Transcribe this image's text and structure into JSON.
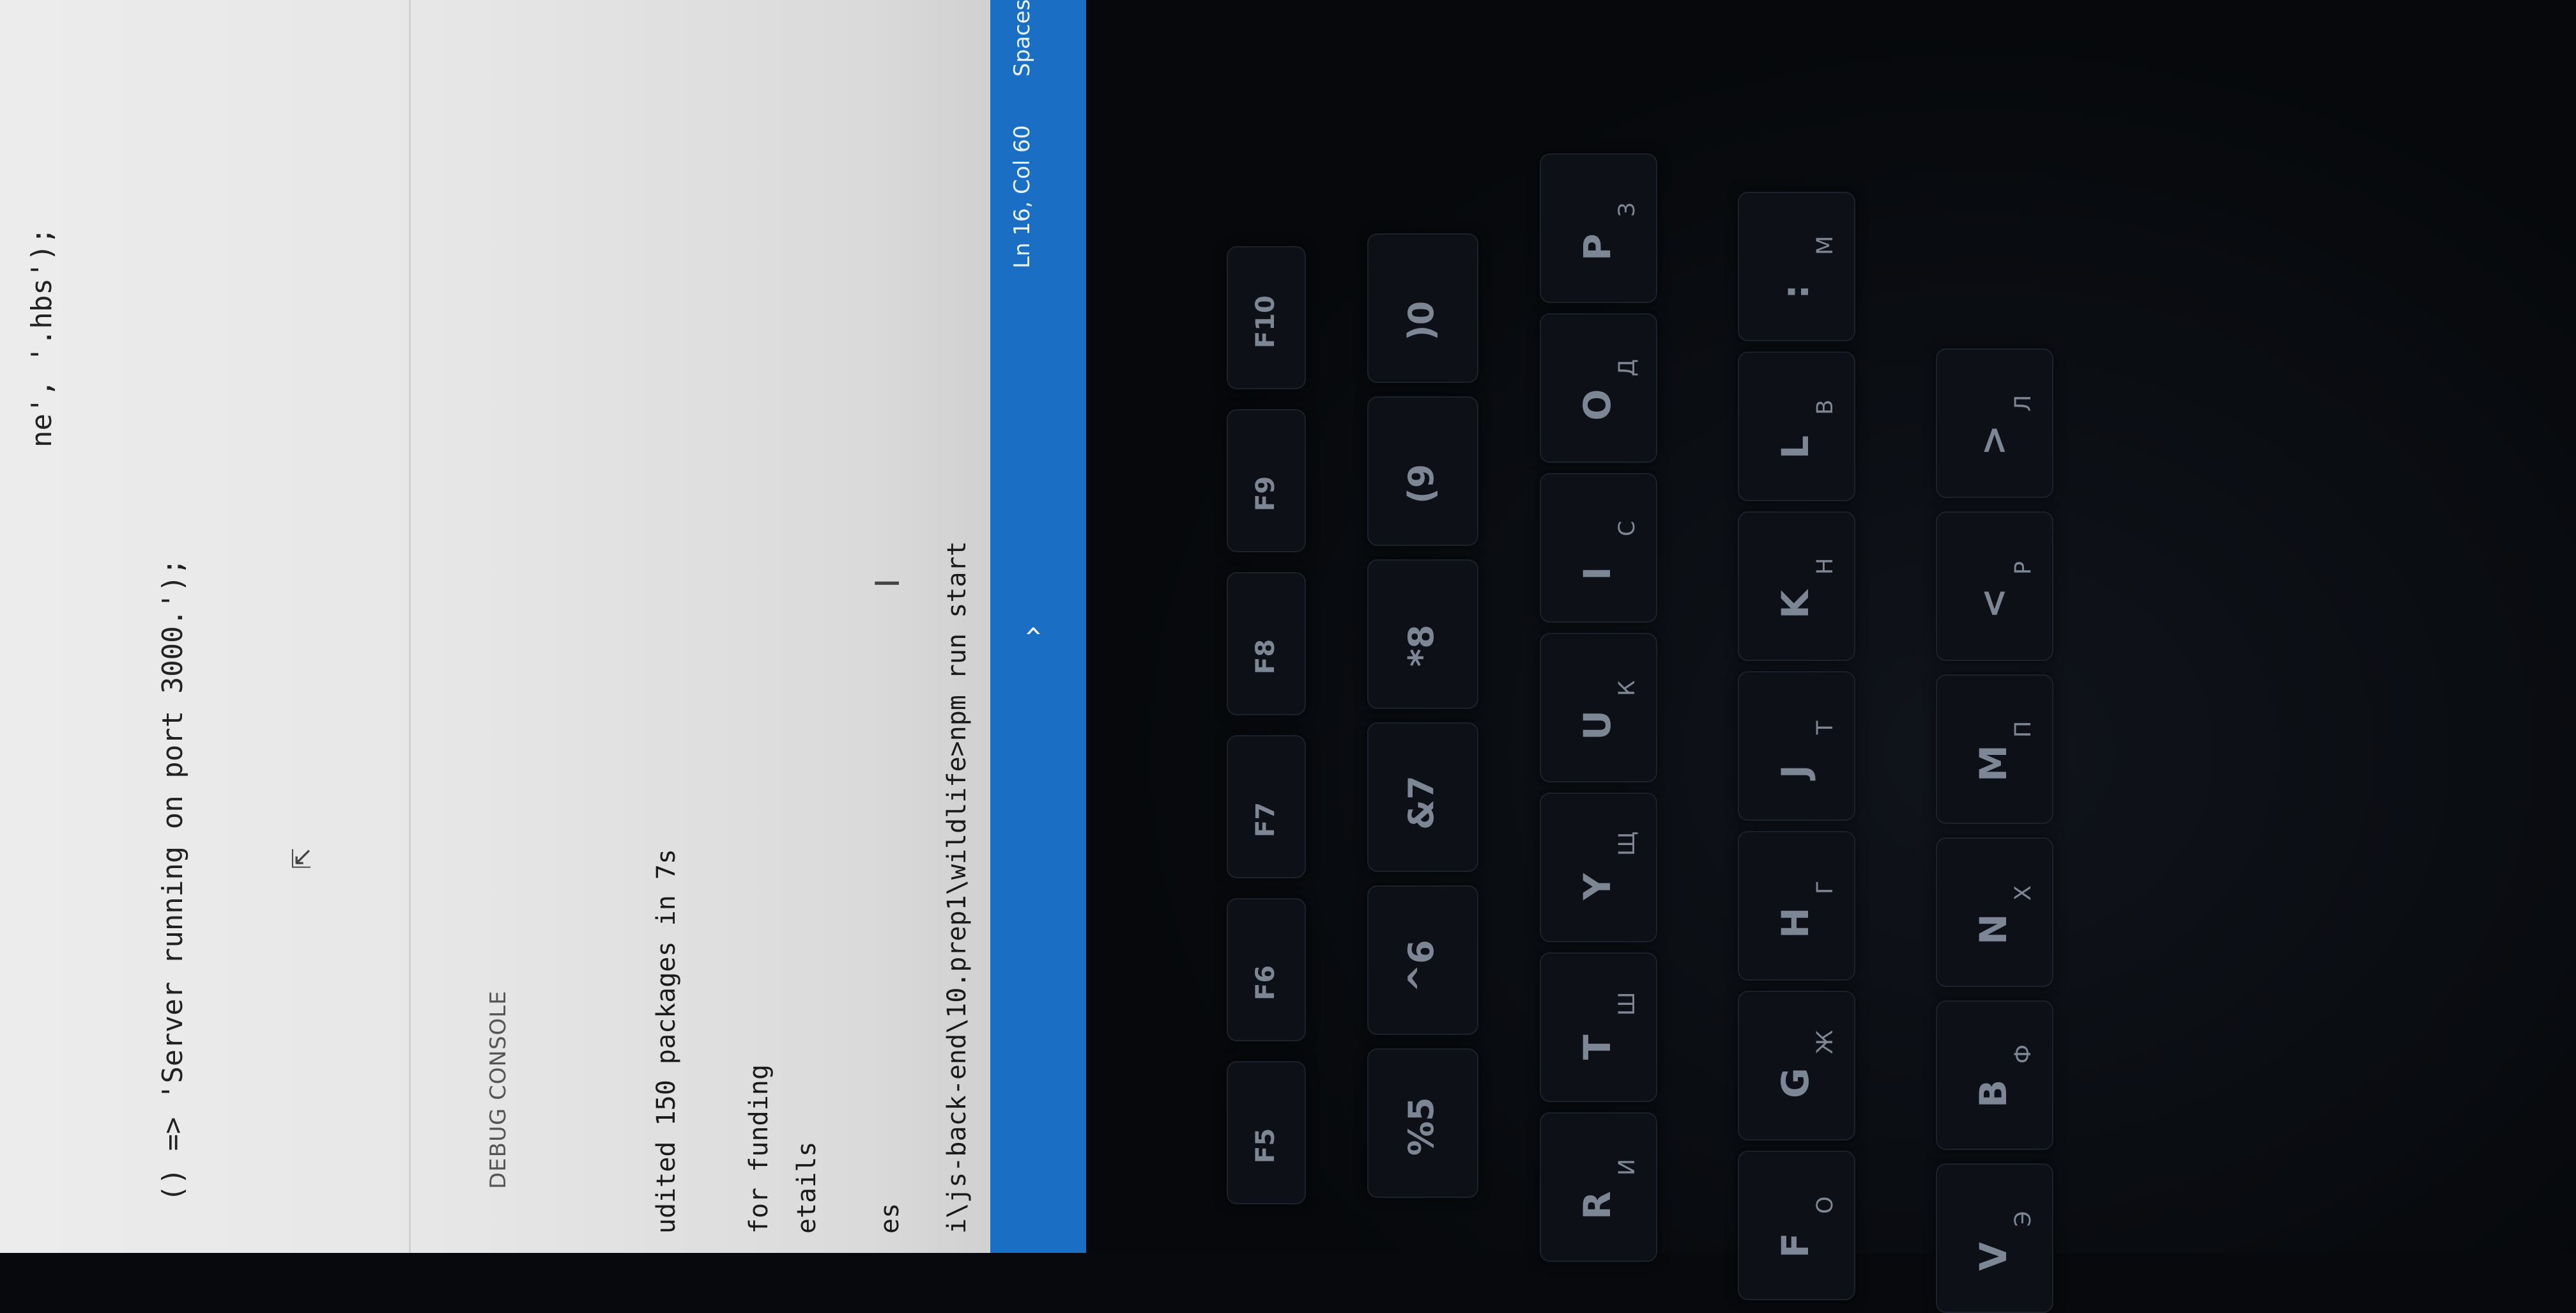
{
  "editor": {
    "line1": "ne', '.hbs');",
    "line2": "() => 'Server running on port 3000.');"
  },
  "panel": {
    "tab_label": "DEBUG CONSOLE"
  },
  "terminal": {
    "line1": "udited 150 packages in 7s",
    "line2": "for funding",
    "line3": "etails",
    "line4": "es",
    "line5": "i\\js-back-end\\10.prep1\\wildlife>npm run start"
  },
  "statusbar": {
    "position": "Ln 16, Col 60",
    "spaces": "Spaces",
    "color": "#1a6fc4"
  },
  "keyboard": {
    "fn_row": [
      "F5",
      "F6",
      "F7",
      "F8",
      "F9",
      "F10"
    ],
    "num_row": [
      "%5",
      "^6",
      "&7",
      "*8",
      "(9",
      ")0"
    ],
    "top_row": [
      {
        "en": "R",
        "ru": "И"
      },
      {
        "en": "T",
        "ru": "Ш"
      },
      {
        "en": "Y",
        "ru": "Щ"
      },
      {
        "en": "U",
        "ru": "К"
      },
      {
        "en": "I",
        "ru": "С"
      },
      {
        "en": "O",
        "ru": "Д"
      },
      {
        "en": "P",
        "ru": "З"
      }
    ],
    "mid_row": [
      {
        "en": "F",
        "ru": "О"
      },
      {
        "en": "G",
        "ru": "Ж"
      },
      {
        "en": "H",
        "ru": "Г"
      },
      {
        "en": "J",
        "ru": "Т"
      },
      {
        "en": "K",
        "ru": "Н"
      },
      {
        "en": "L",
        "ru": "В"
      },
      {
        "en": ":",
        "ru": "М"
      }
    ],
    "bot_row": [
      {
        "en": "V",
        "ru": "Э"
      },
      {
        "en": "B",
        "ru": "Ф"
      },
      {
        "en": "N",
        "ru": "Х"
      },
      {
        "en": "M",
        "ru": "П"
      },
      {
        "en": "<",
        "ru": "Р"
      },
      {
        "en": ">",
        "ru": "Л"
      }
    ]
  }
}
